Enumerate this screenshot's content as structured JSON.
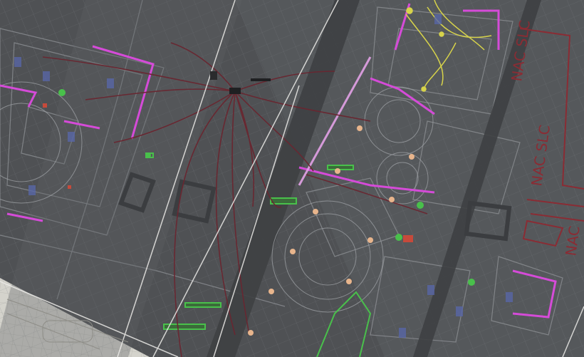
{
  "image": {
    "subject": "overlaid architectural floor plan drawings with fire alarm wiring runs",
    "labels": {
      "nac_slc_1": "NAC SLC",
      "nac_slc_2": "NAC SLC",
      "nac_3": "NAC"
    },
    "palette": {
      "sheet_dark": "#4b4d50",
      "sheet_mid": "#5a5c5f",
      "sheet_light": "#d7d6cf",
      "linework": "#8c8f93",
      "wiring": "#6a2630",
      "highlight": "#d54bd8",
      "device_green": "#49c04b",
      "device_yellow": "#d7d34a",
      "device_peach": "#e8b58c",
      "guide_white": "#ecebe8",
      "annotation_red": "#8a2c34"
    }
  }
}
